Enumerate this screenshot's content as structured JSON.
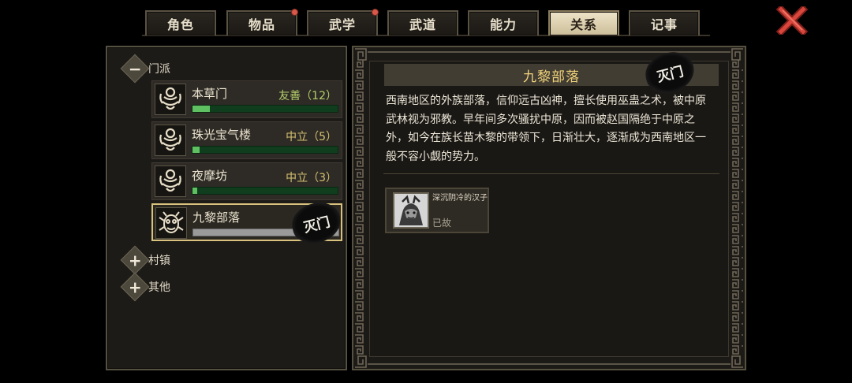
{
  "tabs": [
    {
      "label": "角色",
      "badge": false,
      "active": false
    },
    {
      "label": "物品",
      "badge": true,
      "active": false
    },
    {
      "label": "武学",
      "badge": true,
      "active": false
    },
    {
      "label": "武道",
      "badge": false,
      "active": false
    },
    {
      "label": "能力",
      "badge": false,
      "active": false
    },
    {
      "label": "关系",
      "badge": false,
      "active": true
    },
    {
      "label": "记事",
      "badge": false,
      "active": false
    }
  ],
  "tree": {
    "sect": {
      "label": "门派",
      "expanded": true
    },
    "town": {
      "label": "村镇",
      "expanded": false
    },
    "other": {
      "label": "其他",
      "expanded": false
    }
  },
  "factions": [
    {
      "name": "本草门",
      "status": "友善（12）",
      "status_color": "#b5cf6a",
      "progress": 0.12,
      "selected": false,
      "destroyed": false
    },
    {
      "name": "珠光宝气楼",
      "status": "中立（5）",
      "status_color": "#d4c070",
      "progress": 0.05,
      "selected": false,
      "destroyed": false
    },
    {
      "name": "夜摩坊",
      "status": "中立（3）",
      "status_color": "#d4c070",
      "progress": 0.03,
      "selected": false,
      "destroyed": false
    },
    {
      "name": "九黎部落",
      "status": "",
      "status_color": "",
      "progress": 1.0,
      "selected": true,
      "destroyed": true
    }
  ],
  "stamp_text": "灭门",
  "detail": {
    "title": "九黎部落",
    "description": "西南地区的外族部落，信仰远古凶神，擅长使用巫蛊之术，被中原武林视为邪教。早年间多次骚扰中原，因而被赵国隔绝于中原之外，如今在族长苗木黎的带领下，日渐壮大，逐渐成为西南地区一般不容小觑的势力。",
    "member": {
      "name": "深沉阴冷的汉子",
      "state": "已故"
    }
  },
  "colors": {
    "accent_gold": "#f0d27a",
    "friendly": "#b5cf6a",
    "bar_green": "#5fc062",
    "close_red": "#d8463c"
  },
  "icons": {
    "close": "close-x-icon",
    "faction": "faction-emblem-icon",
    "tree_expand": "plus-icon",
    "tree_collapse": "minus-icon"
  }
}
